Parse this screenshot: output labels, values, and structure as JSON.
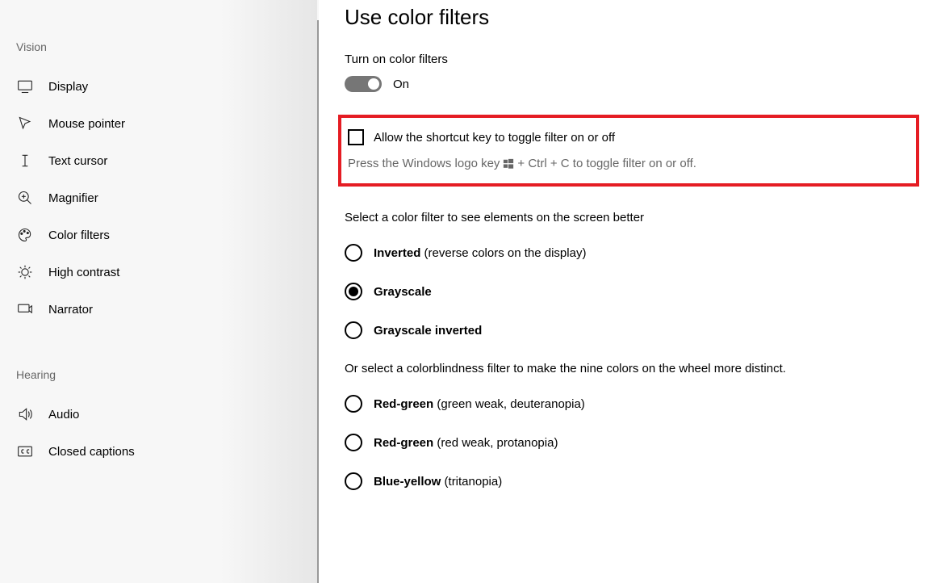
{
  "sidebar": {
    "groups": [
      {
        "header": "Vision",
        "items": [
          {
            "label": "Display"
          },
          {
            "label": "Mouse pointer"
          },
          {
            "label": "Text cursor"
          },
          {
            "label": "Magnifier"
          },
          {
            "label": "Color filters"
          },
          {
            "label": "High contrast"
          },
          {
            "label": "Narrator"
          }
        ]
      },
      {
        "header": "Hearing",
        "items": [
          {
            "label": "Audio"
          },
          {
            "label": "Closed captions"
          }
        ]
      }
    ]
  },
  "main": {
    "title": "Use color filters",
    "toggle_label": "Turn on color filters",
    "toggle_state": "On",
    "shortcut_checkbox_label": "Allow the shortcut key to toggle filter on or off",
    "shortcut_hint_before": "Press the Windows logo key",
    "shortcut_hint_after": "+ Ctrl + C to toggle filter on or off.",
    "section1_text": "Select a color filter to see elements on the screen better",
    "filters": [
      {
        "bold": "Inverted",
        "rest": " (reverse colors on the display)",
        "checked": false
      },
      {
        "bold": "Grayscale",
        "rest": "",
        "checked": true
      },
      {
        "bold": "Grayscale inverted",
        "rest": "",
        "checked": false
      }
    ],
    "section2_text": "Or select a colorblindness filter to make the nine colors on the wheel more distinct.",
    "cb_filters": [
      {
        "bold": "Red-green",
        "rest": " (green weak, deuteranopia)",
        "checked": false
      },
      {
        "bold": "Red-green",
        "rest": " (red weak, protanopia)",
        "checked": false
      },
      {
        "bold": "Blue-yellow",
        "rest": " (tritanopia)",
        "checked": false
      }
    ]
  }
}
